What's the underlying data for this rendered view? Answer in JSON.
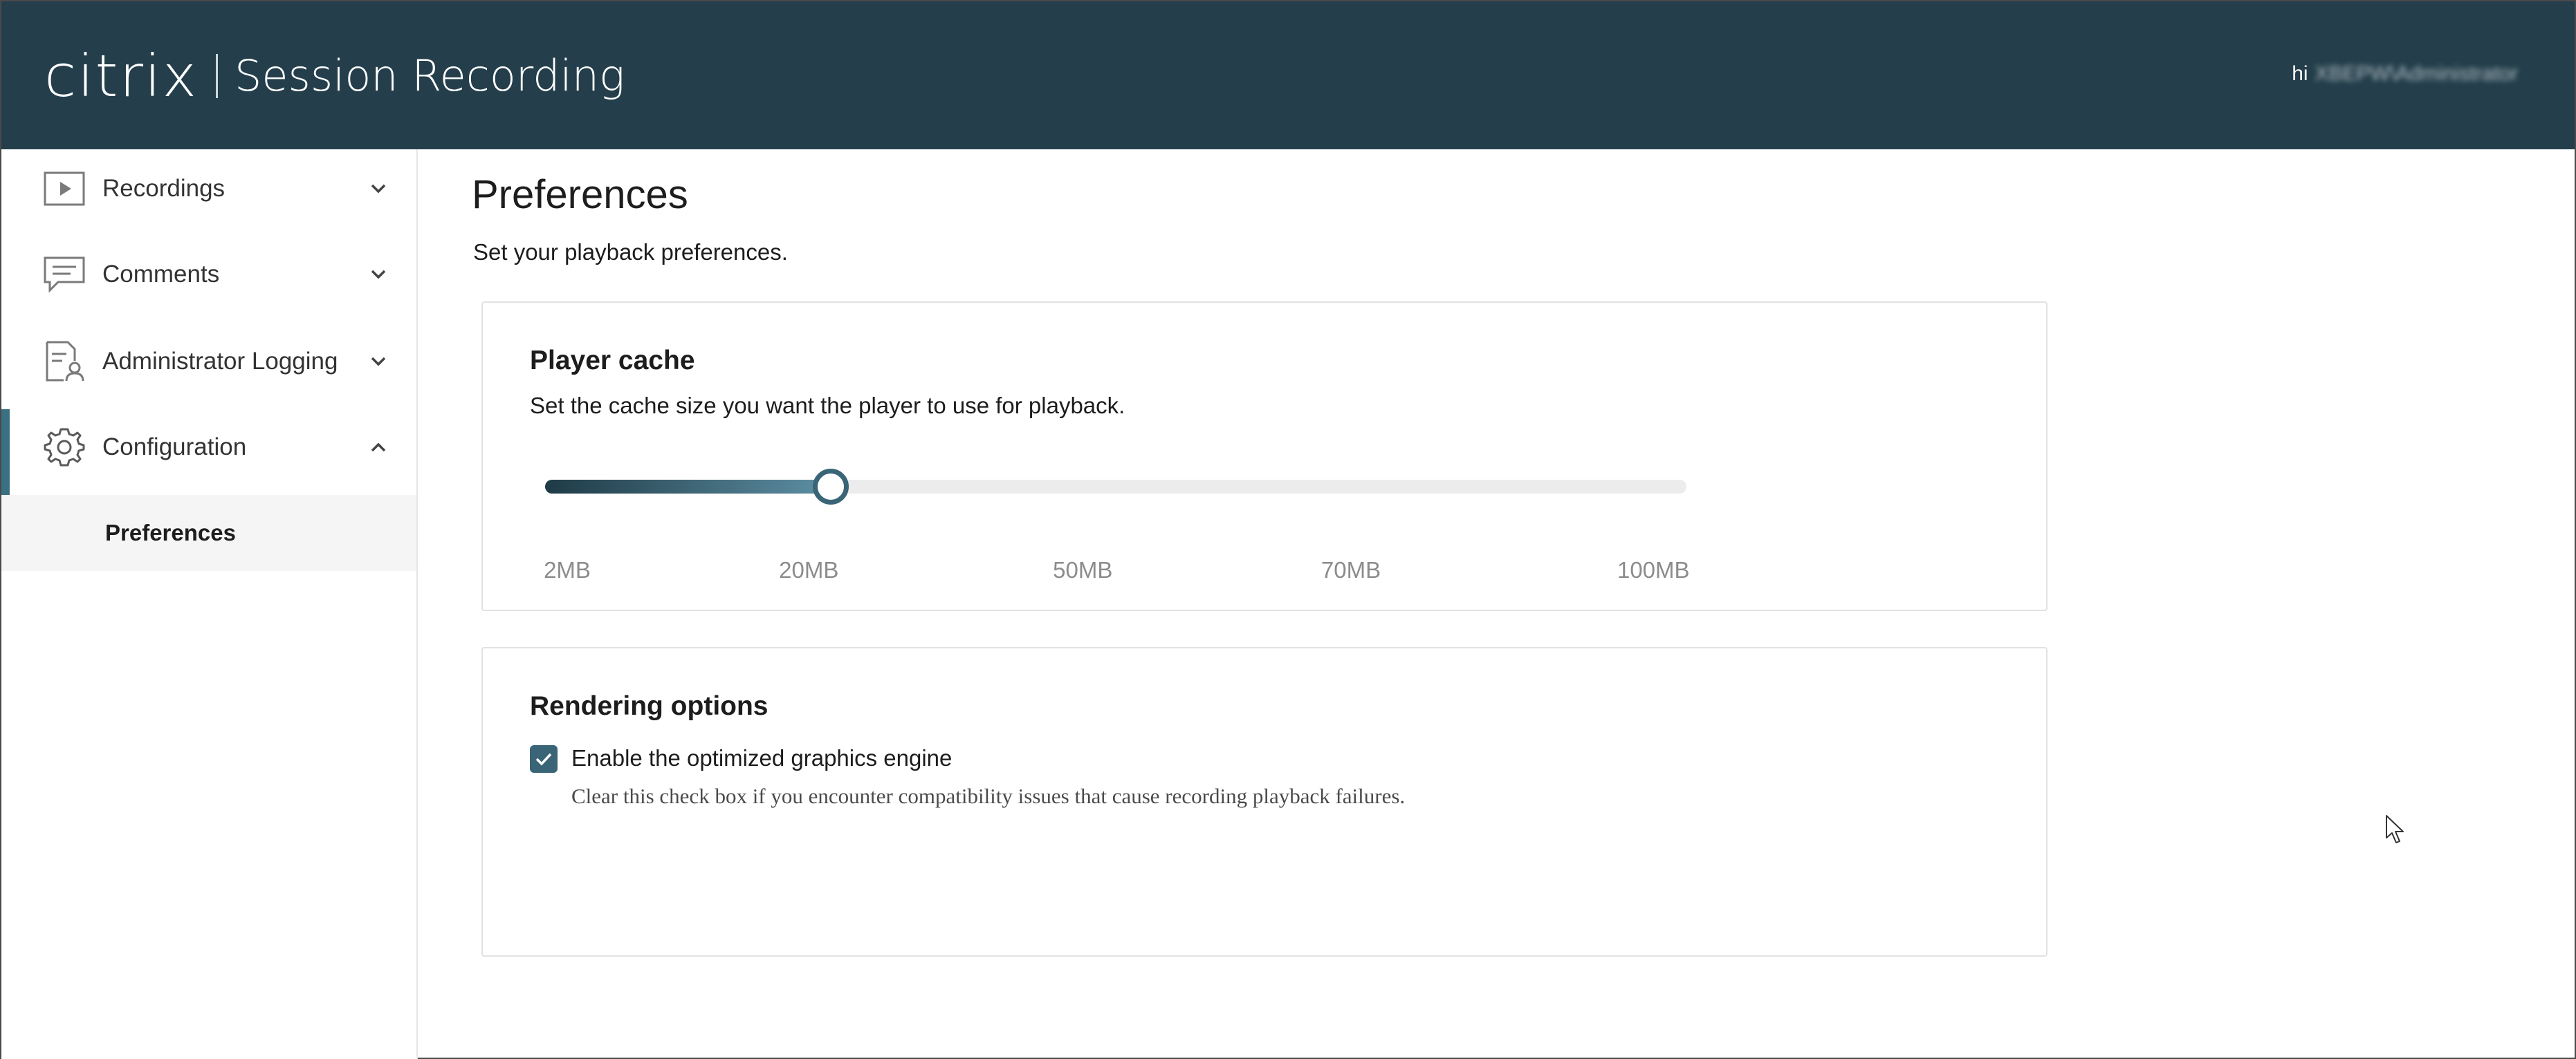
{
  "header": {
    "logo_text": "citrix",
    "product_name": "Session Recording",
    "greeting": "hi",
    "user_name": "XBEPW\\Administrator"
  },
  "sidebar": {
    "items": [
      {
        "label": "Recordings",
        "icon": "play-icon",
        "expanded": false
      },
      {
        "label": "Comments",
        "icon": "comment-icon",
        "expanded": false
      },
      {
        "label": "Administrator Logging",
        "icon": "log-icon",
        "expanded": false
      },
      {
        "label": "Configuration",
        "icon": "gear-icon",
        "expanded": true,
        "active": true
      }
    ],
    "subitems": [
      {
        "label": "Preferences",
        "selected": true
      }
    ]
  },
  "main": {
    "title": "Preferences",
    "subtitle": "Set your playback preferences.",
    "player_cache": {
      "title": "Player cache",
      "description": "Set the cache size you want the player to use for playback.",
      "options": [
        "2MB",
        "20MB",
        "50MB",
        "70MB",
        "100MB"
      ],
      "selected": "20MB",
      "selected_index": 1
    },
    "rendering": {
      "title": "Rendering options",
      "checkbox_label": "Enable the optimized graphics engine",
      "checkbox_checked": true,
      "help_text": "Clear this check box if you encounter compatibility issues that cause recording playback failures."
    }
  },
  "colors": {
    "header_bg": "#243f4b",
    "accent": "#3a6577",
    "active_bar": "#3b6f82"
  }
}
